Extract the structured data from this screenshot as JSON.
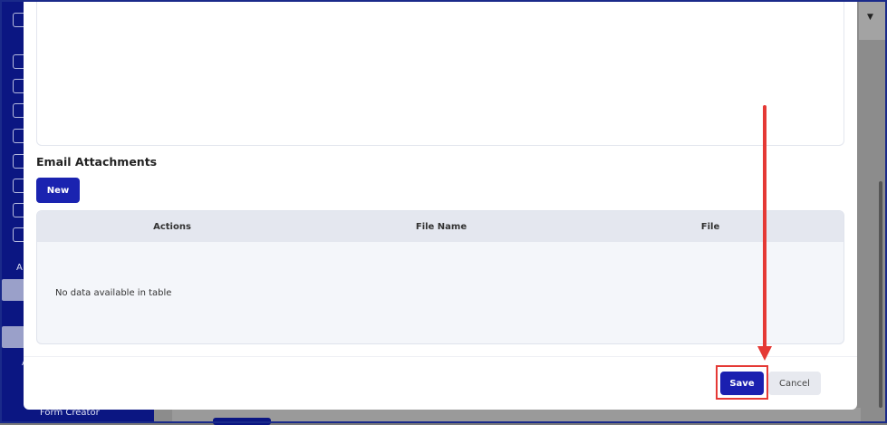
{
  "background": {
    "sidebar_section_letters": [
      "A",
      "A"
    ],
    "sidebar_bottom_item": "Form Creator"
  },
  "editor": {
    "faint_text": "( ) ( )"
  },
  "attachments": {
    "title": "Email Attachments",
    "new_label": "New",
    "columns": [
      "Actions",
      "File Name",
      "File"
    ],
    "empty_message": "No data available in table"
  },
  "footer": {
    "save_label": "Save",
    "cancel_label": "Cancel"
  },
  "colors": {
    "primary": "#1a23b0",
    "annotation": "#e53935",
    "sidebar": "#0b1682"
  },
  "icons": [
    "dropdown-caret-icon",
    "sidebar-chart-icon",
    "sidebar-table-icon",
    "sidebar-user-icon"
  ]
}
